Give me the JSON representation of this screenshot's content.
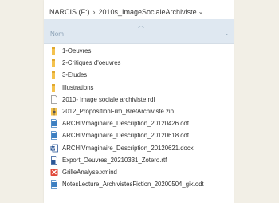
{
  "breadcrumb": {
    "drive": "NARCIS (F:)",
    "folder": "2010s_ImageSocialeArchiviste"
  },
  "header": {
    "name_column": "Nom"
  },
  "files": [
    {
      "name": "1-Oeuvres",
      "icon": "folder-icon"
    },
    {
      "name": "2-Critiques d'oeuvres",
      "icon": "folder-icon"
    },
    {
      "name": "3-Etudes",
      "icon": "folder-icon"
    },
    {
      "name": "Illustrations",
      "icon": "folder-icon"
    },
    {
      "name": "2010- Image sociale archiviste.rdf",
      "icon": "document-icon"
    },
    {
      "name": "2012_PropositionFilm_BrefArchiviste.zip",
      "icon": "zip-icon"
    },
    {
      "name": "ARCHIVmaginaire_Description_20120426.odt",
      "icon": "odt-icon"
    },
    {
      "name": "ARCHIVmaginaire_Description_20120618.odt",
      "icon": "odt-icon"
    },
    {
      "name": "ARCHIVmaginaire_Description_20120621.docx",
      "icon": "word-icon"
    },
    {
      "name": "Export_Oeuvres_20210331_Zotero.rtf",
      "icon": "rtf-icon"
    },
    {
      "name": "GrilleAnalyse.xmind",
      "icon": "xmind-icon"
    },
    {
      "name": "NotesLecture_ArchivistesFiction_20200504_gik.odt",
      "icon": "odt-icon"
    }
  ],
  "colors": {
    "folder": "#f4c24e",
    "word": "#2b5797",
    "odt": "#3d7fc1",
    "xmind": "#e0483a",
    "header_bg": "#dfe8f1"
  }
}
